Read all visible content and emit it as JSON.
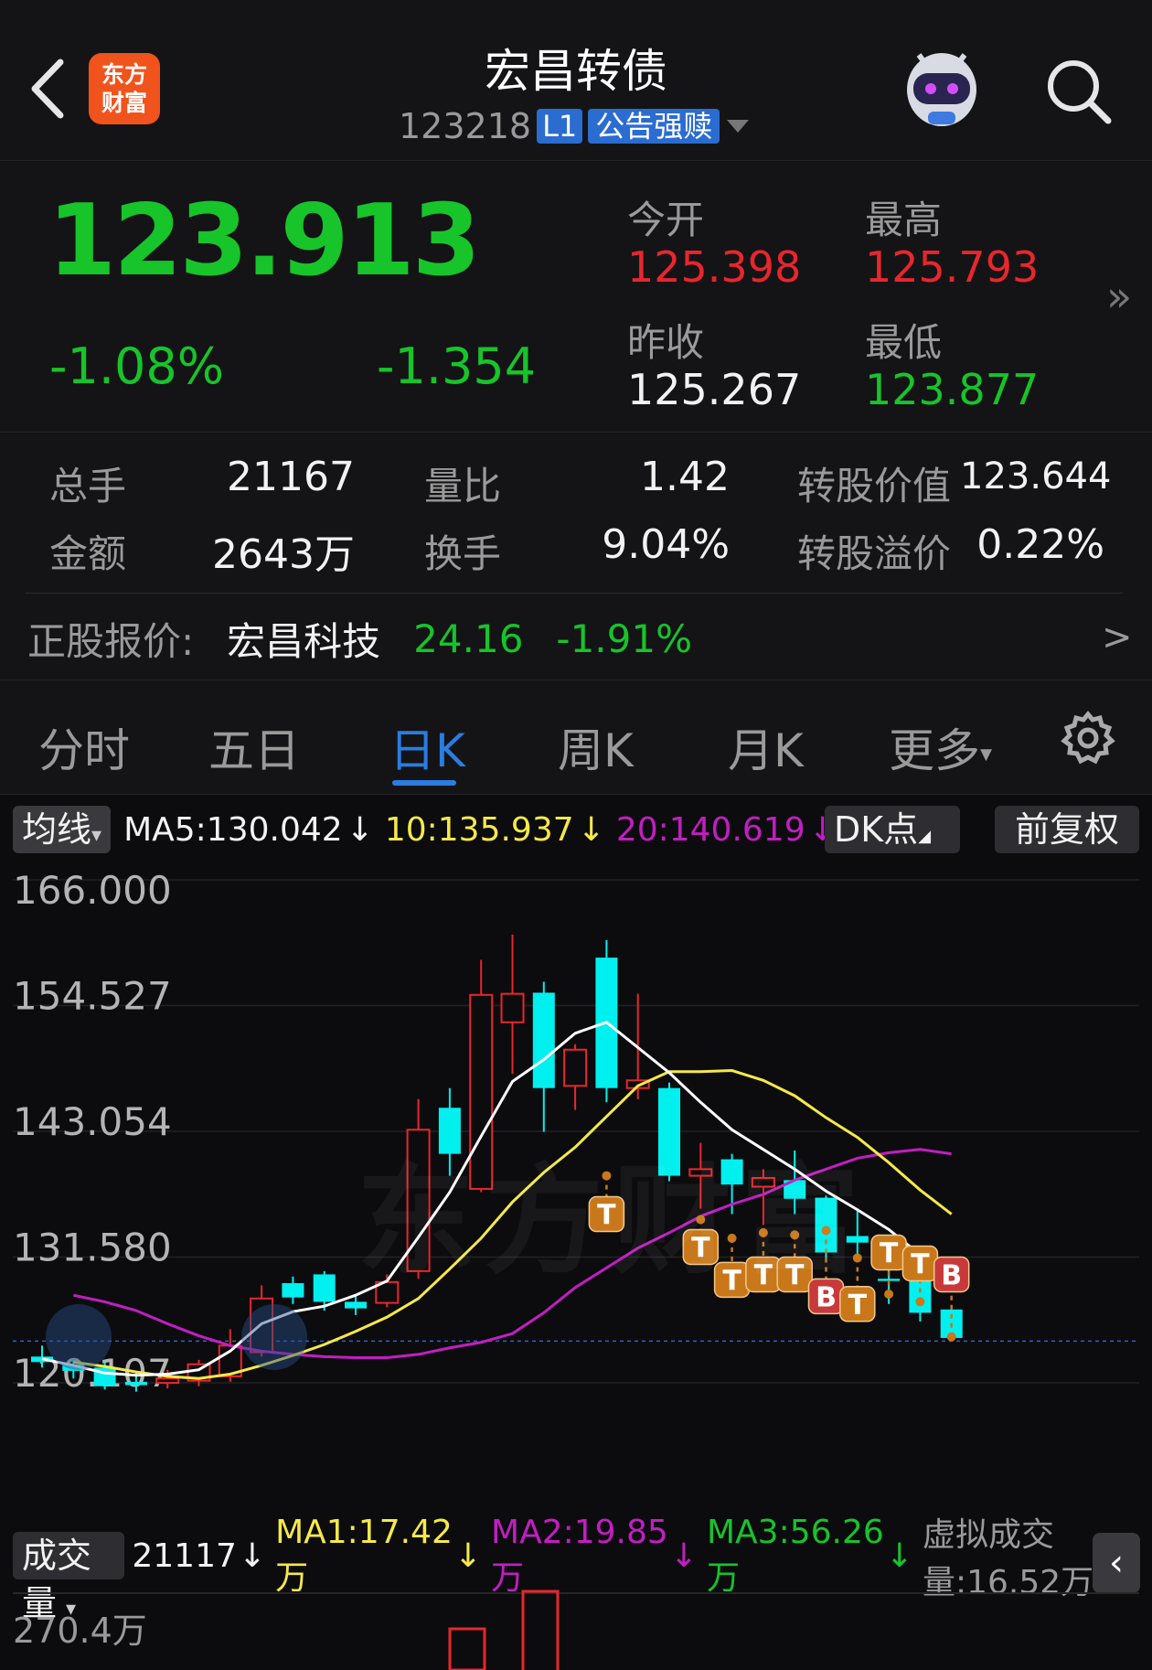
{
  "header": {
    "title": "宏昌转债",
    "code": "123218",
    "level_tag": "L1",
    "status_tag": "公告强赎",
    "logo_text_1": "东方",
    "logo_text_2": "财富"
  },
  "quote": {
    "price": "123.913",
    "change_pct": "-1.08%",
    "change": "-1.354",
    "open_label": "今开",
    "open": "125.398",
    "high_label": "最高",
    "high": "125.793",
    "prev_close_label": "昨收",
    "prev_close": "125.267",
    "low_label": "最低",
    "low": "123.877",
    "more_icon": "»"
  },
  "stats": {
    "volume_label": "总手",
    "volume": "21167",
    "vol_ratio_label": "量比",
    "vol_ratio": "1.42",
    "conv_value_label": "转股价值",
    "conv_value": "123.644",
    "amount_label": "金额",
    "amount": "2643万",
    "turnover_label": "换手",
    "turnover": "9.04%",
    "premium_label": "转股溢价",
    "premium": "0.22%",
    "stock_label": "正股报价:",
    "stock_name": "宏昌科技",
    "stock_price": "24.16",
    "stock_change": "-1.91%",
    "arrow": ">"
  },
  "tabs": [
    "分时",
    "五日",
    "日K",
    "周K",
    "月K",
    "更多"
  ],
  "active_tab": "日K",
  "chart_controls": {
    "ma_select": "均线",
    "ma5": "MA5:130.042",
    "ma10": "10:135.937",
    "ma20": "20:140.619",
    "dk_button": "DK点",
    "adjust_button": "前复权",
    "vol_select": "成交量",
    "vol_now": "21117",
    "vol_ma1": "MA1:17.42万",
    "vol_ma2": "MA2:19.85万",
    "vol_ma3": "MA3:56.26万",
    "virtual_vol": "虚拟成交量:16.52万",
    "vol_axis_top": "270.4万",
    "watermark": "东方财富"
  },
  "colors": {
    "up": "#e8262d",
    "down": "#00f0f0",
    "ma5": "#ffffff",
    "ma10": "#f5e94a",
    "ma20": "#c21ec2",
    "signal": "#c8781a"
  },
  "chart_data": {
    "type": "candlestick",
    "y_ticks": [
      "166.000",
      "154.527",
      "143.054",
      "131.580",
      "120.107"
    ],
    "ylim": [
      120.107,
      166.0
    ],
    "candles": [
      {
        "o": 122.5,
        "c": 122.0,
        "h": 123.5,
        "l": 121.5
      },
      {
        "o": 121.8,
        "c": 121.2,
        "h": 122.3,
        "l": 120.5
      },
      {
        "o": 121.5,
        "c": 119.8,
        "h": 122.0,
        "l": 119.5
      },
      {
        "o": 120.2,
        "c": 119.9,
        "h": 121.0,
        "l": 119.3
      },
      {
        "o": 120.1,
        "c": 120.5,
        "h": 121.3,
        "l": 119.6
      },
      {
        "o": 120.3,
        "c": 121.8,
        "h": 122.2,
        "l": 119.8
      },
      {
        "o": 120.7,
        "c": 123.5,
        "h": 125.0,
        "l": 120.2
      },
      {
        "o": 122.9,
        "c": 127.8,
        "h": 129.0,
        "l": 122.5
      },
      {
        "o": 129.2,
        "c": 127.9,
        "h": 129.8,
        "l": 127.3
      },
      {
        "o": 130.0,
        "c": 127.5,
        "h": 130.3,
        "l": 126.7
      },
      {
        "o": 127.5,
        "c": 126.9,
        "h": 128.0,
        "l": 126.3
      },
      {
        "o": 127.4,
        "c": 129.3,
        "h": 130.0,
        "l": 127.0
      },
      {
        "o": 130.3,
        "c": 143.2,
        "h": 146.0,
        "l": 129.6
      },
      {
        "o": 145.2,
        "c": 141.0,
        "h": 147.0,
        "l": 139.0
      },
      {
        "o": 137.8,
        "c": 155.5,
        "h": 158.7,
        "l": 137.5
      },
      {
        "o": 153.0,
        "c": 155.6,
        "h": 161.0,
        "l": 148.3
      },
      {
        "o": 155.7,
        "c": 147.0,
        "h": 156.7,
        "l": 143.0
      },
      {
        "o": 147.2,
        "c": 150.5,
        "h": 151.0,
        "l": 145.0
      },
      {
        "o": 158.9,
        "c": 147.0,
        "h": 160.5,
        "l": 145.7
      },
      {
        "o": 147.0,
        "c": 147.7,
        "h": 155.6,
        "l": 146.0
      },
      {
        "o": 147.0,
        "c": 139.0,
        "h": 147.5,
        "l": 138.5
      },
      {
        "o": 139.0,
        "c": 139.6,
        "h": 142.0,
        "l": 136.0
      },
      {
        "o": 140.5,
        "c": 138.2,
        "h": 141.0,
        "l": 135.5
      },
      {
        "o": 138.0,
        "c": 138.8,
        "h": 139.6,
        "l": 134.5
      },
      {
        "o": 138.6,
        "c": 136.9,
        "h": 141.3,
        "l": 135.5
      },
      {
        "o": 137.0,
        "c": 132.0,
        "h": 137.2,
        "l": 131.5
      },
      {
        "o": 133.5,
        "c": 132.9,
        "h": 135.8,
        "l": 131.5
      },
      {
        "o": 129.6,
        "c": 129.4,
        "h": 131.0,
        "l": 127.3
      },
      {
        "o": 129.9,
        "c": 126.5,
        "h": 130.3,
        "l": 125.7
      },
      {
        "o": 126.8,
        "c": 124.2,
        "h": 126.9,
        "l": 124.0
      }
    ],
    "ma5": [
      122.3,
      121.7,
      121.0,
      120.8,
      120.9,
      121.3,
      123.0,
      125.5,
      126.6,
      127.1,
      128.1,
      129.4,
      133.4,
      137.5,
      142.6,
      147.6,
      149.6,
      152.0,
      153.0,
      150.7,
      148.4,
      145.7,
      143.2,
      141.4,
      139.6,
      137.6,
      135.9,
      134.1,
      131.8,
      130.0
    ],
    "ma10": [
      122.0,
      121.6,
      121.1,
      120.7,
      120.5,
      120.9,
      121.7,
      122.6,
      123.6,
      124.8,
      126.1,
      127.8,
      130.5,
      133.3,
      136.6,
      139.3,
      141.6,
      144.4,
      147.2,
      148.5,
      148.5,
      148.6,
      147.7,
      146.3,
      144.3,
      142.5,
      140.2,
      137.7,
      135.5
    ],
    "ma20": [
      128.1,
      127.5,
      126.7,
      125.5,
      124.4,
      123.5,
      123.0,
      122.7,
      122.5,
      122.4,
      122.4,
      122.7,
      123.3,
      123.8,
      124.6,
      126.5,
      128.8,
      130.6,
      132.4,
      133.8,
      135.3,
      136.4,
      137.3,
      138.6,
      139.6,
      140.6,
      141.1,
      141.4,
      141.0
    ]
  }
}
